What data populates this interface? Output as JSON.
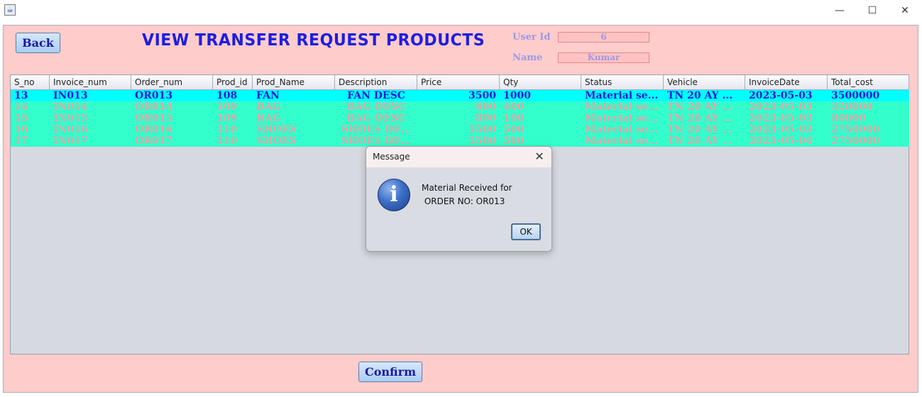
{
  "window": {
    "icon": "java-cup-icon",
    "controls": {
      "minimize": "—",
      "maximize": "☐",
      "close": "✕"
    }
  },
  "header": {
    "back_label": "Back",
    "title": "VIEW TRANSFER REQUEST PRODUCTS",
    "user_id_label": "User Id",
    "user_id_value": "6",
    "name_label": "Name",
    "name_value": "Kumar"
  },
  "table": {
    "columns": [
      "S_no",
      "Invoice_num",
      "Order_num",
      "Prod_id",
      "Prod_Name",
      "Description",
      "Price",
      "Qty",
      "Status",
      "Vehicle",
      "InvoiceDate",
      "Total_cost"
    ],
    "rows": [
      {
        "selected": true,
        "cells": [
          "13",
          "IN013",
          "OR013",
          "108",
          "FAN",
          "FAN DESC",
          "3500",
          "1000",
          "Material se...",
          "TN 20 AY ...",
          "2023-05-03",
          "3500000"
        ]
      },
      {
        "selected": false,
        "cells": [
          "14",
          "IN014",
          "OR014",
          "109",
          "BAG",
          "BAG DESC",
          "800",
          "400",
          "Material se...",
          "TN 20 AY ...",
          "2023-05-03",
          "320000"
        ]
      },
      {
        "selected": false,
        "cells": [
          "15",
          "IN015",
          "OR015",
          "109",
          "BAG",
          "BAG DESC",
          "800",
          "100",
          "Material se...",
          "TN 20 AY ...",
          "2023-05-03",
          "80000"
        ]
      },
      {
        "selected": false,
        "cells": [
          "16",
          "IN016",
          "OR016",
          "110",
          "SHOES",
          "SHOES DE...",
          "5500",
          "500",
          "Material se...",
          "TN 20 AY ...",
          "2023-05-03",
          "2750000"
        ]
      },
      {
        "selected": false,
        "cells": [
          "17",
          "IN017",
          "OR017",
          "110",
          "SHOES",
          "SHOES DE...",
          "5500",
          "500",
          "Material se...",
          "TN 20 AY ...",
          "2023-05-04",
          "2750000"
        ]
      }
    ]
  },
  "footer": {
    "confirm_label": "Confirm"
  },
  "dialog": {
    "title": "Message",
    "close_glyph": "✕",
    "icon": "information-icon",
    "message_line1": "Material Received for",
    "message_line2": " ORDER NO: OR013",
    "ok_label": "OK"
  },
  "colors": {
    "frame_bg": "#ffcccc",
    "selected_row_bg": "#00ffff",
    "row_bg": "#33ffcc",
    "title_text": "#1e1ee0"
  }
}
